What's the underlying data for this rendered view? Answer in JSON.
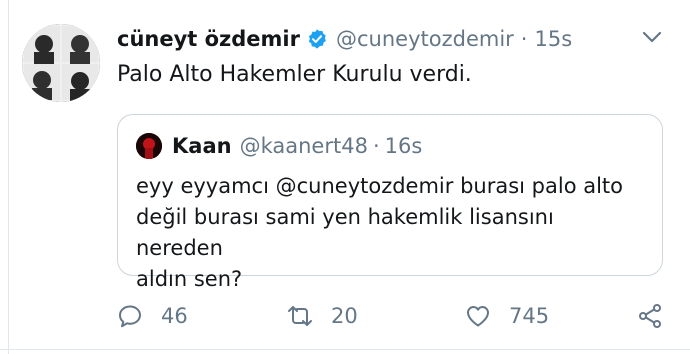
{
  "tweet": {
    "display_name": "cüneyt özdemir",
    "handle": "@cuneytozdemir",
    "separator": "·",
    "time": "15s",
    "text": "Palo Alto Hakemler Kurulu verdi.",
    "verified_icon": "verified-badge-icon",
    "menu_icon": "chevron-down-icon"
  },
  "quoted": {
    "display_name": "Kaan",
    "handle": "@kaanert48",
    "separator": "·",
    "time": "16s",
    "lines": [
      "eyy eyyamcı @cuneytozdemir burası palo alto",
      "değil burası sami yen hakemlik lisansını nereden",
      "aldın sen?"
    ]
  },
  "actions": {
    "reply_count": "46",
    "retweet_count": "20",
    "like_count": "745"
  },
  "colors": {
    "verified": "#1da1f2",
    "secondary_text": "#657786",
    "border": "#ccd6dd"
  }
}
